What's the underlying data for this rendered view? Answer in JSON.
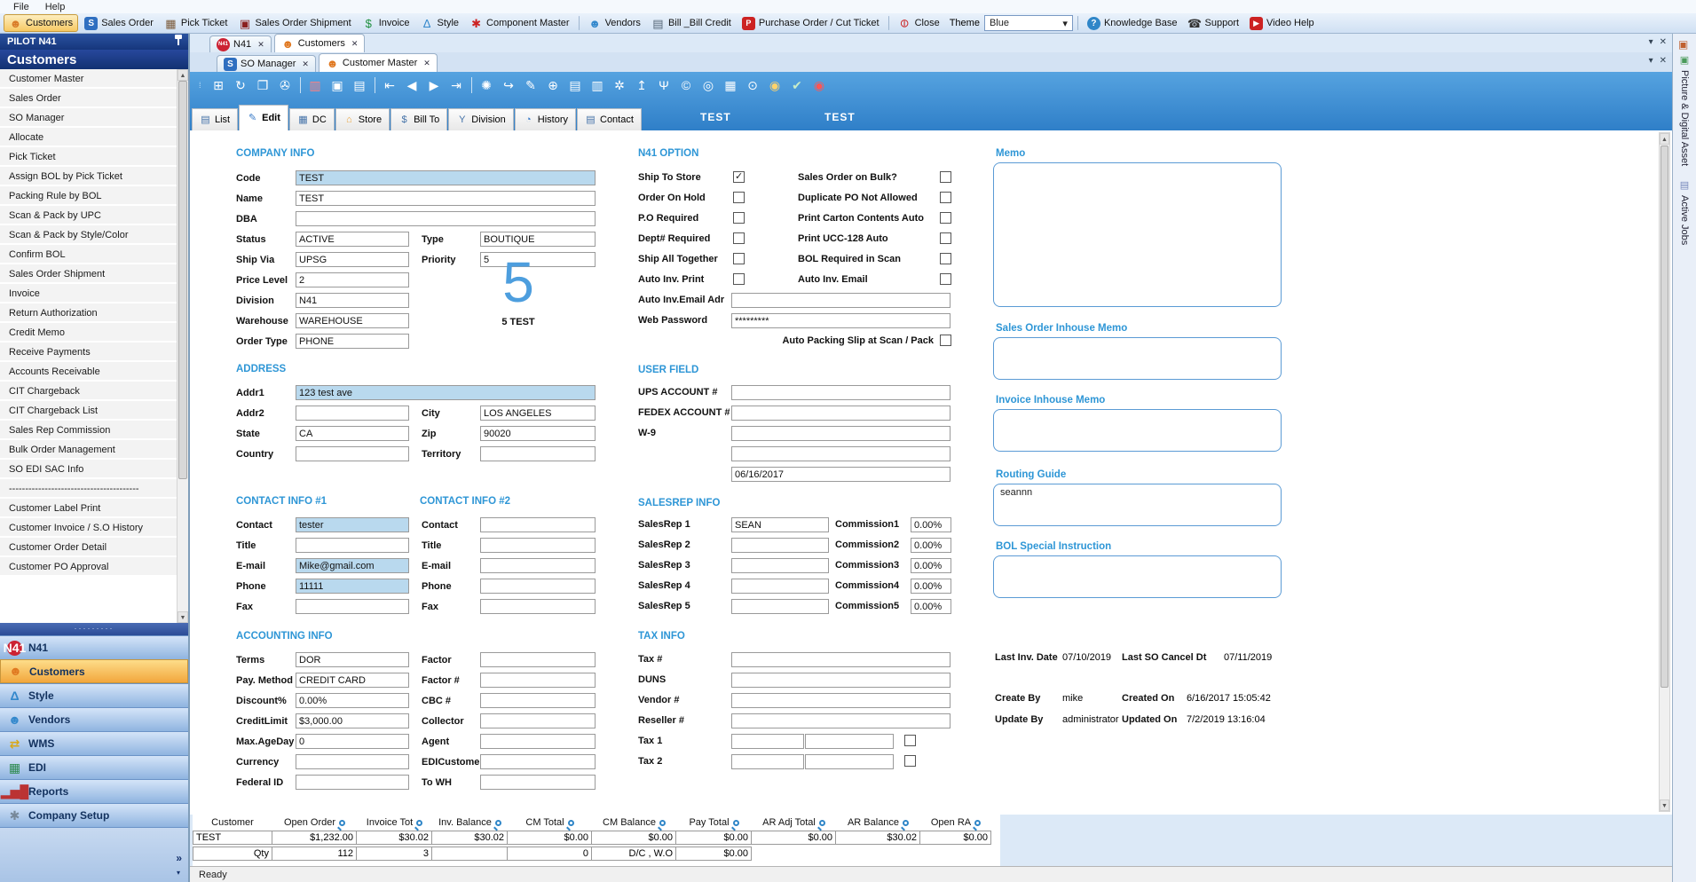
{
  "ui": {
    "close": "✕",
    "caret": "▾",
    "up": "▲",
    "down": "▼",
    "chevron": "»",
    "drag_dots": "⁞",
    "split_dots": "·········"
  },
  "menubar": {
    "items": [
      "File",
      "Help"
    ]
  },
  "toolbar": {
    "buttons": [
      {
        "label": "Customers",
        "icon": "customers-icon",
        "glyph": "☻",
        "color": "#d97c28",
        "active": true
      },
      {
        "label": "Sales Order",
        "icon": "sales-order-icon",
        "glyph": "S",
        "bb": true
      },
      {
        "label": "Pick Ticket",
        "icon": "pick-ticket-icon",
        "glyph": "▦",
        "color": "#7a5a3a"
      },
      {
        "label": "Sales Order Shipment",
        "icon": "shipment-icon",
        "glyph": "▣",
        "color": "#8b2020"
      },
      {
        "label": "Invoice",
        "icon": "invoice-icon",
        "glyph": "$",
        "color": "#1e8f3e"
      },
      {
        "label": "Style",
        "icon": "style-icon",
        "glyph": "Δ",
        "color": "#3388cc"
      },
      {
        "label": "Component Master",
        "icon": "component-master-icon",
        "glyph": "✱",
        "color": "#cc2222"
      },
      {
        "sep": true
      },
      {
        "label": "Vendors",
        "icon": "vendors-icon",
        "glyph": "☻",
        "color": "#3388cc"
      },
      {
        "label": "Bill _Bill Credit",
        "icon": "bill-credit-icon",
        "glyph": "▤",
        "color": "#556677"
      },
      {
        "label": "Purchase Order / Cut Ticket",
        "icon": "purchase-order-icon",
        "glyph": "P",
        "brect": true
      },
      {
        "sep": true
      },
      {
        "label": "Close",
        "icon": "close-icon",
        "glyph": "⊖",
        "color": "#cc2222",
        "rot": true
      }
    ],
    "theme": {
      "label": "Theme",
      "value": "Blue"
    },
    "help": [
      {
        "label": "Knowledge Base",
        "icon": "knowledge-base-icon",
        "glyph": "?",
        "bround": true
      },
      {
        "label": "Support",
        "icon": "support-icon",
        "glyph": "☎",
        "color": "#333333"
      },
      {
        "label": "Video Help",
        "icon": "video-help-icon",
        "glyph": "▶",
        "brect": true
      }
    ]
  },
  "sidebar": {
    "header": "PILOT N41",
    "title": "Customers",
    "items": [
      "Customer Master",
      "Sales Order",
      "SO Manager",
      "Allocate",
      "Pick Ticket",
      "Assign BOL by Pick Ticket",
      "Packing Rule by BOL",
      "Scan & Pack by UPC",
      "Scan & Pack by Style/Color",
      "Confirm BOL",
      "Sales Order Shipment",
      "Invoice",
      "Return Authorization",
      "Credit Memo",
      "Receive Payments",
      "Accounts Receivable",
      "CIT Chargeback",
      "CIT Chargeback List",
      "Sales Rep Commission",
      "Bulk Order Management",
      "SO EDI SAC Info",
      "----------------------------------------",
      "Customer Label Print",
      "Customer Invoice / S.O History",
      "Customer Order Detail",
      "Customer PO Approval"
    ],
    "sections": [
      {
        "label": "N41",
        "icon": "n41-icon",
        "glyph": "N41",
        "br": true
      },
      {
        "label": "Customers",
        "icon": "customers-icon",
        "glyph": "☻",
        "color": "#e07820",
        "active": true
      },
      {
        "label": "Style",
        "icon": "style-icon",
        "glyph": "Δ",
        "color": "#3388cc"
      },
      {
        "label": "Vendors",
        "icon": "vendors-icon",
        "glyph": "☻",
        "color": "#3388cc"
      },
      {
        "label": "WMS",
        "icon": "wms-icon",
        "glyph": "⇄",
        "color": "#d9a817"
      },
      {
        "label": "EDI",
        "icon": "edi-icon",
        "glyph": "▦",
        "color": "#2d8a4e"
      },
      {
        "label": "Reports",
        "icon": "reports-icon",
        "glyph": "▂▅█",
        "color": "#bb3333"
      },
      {
        "label": "Company Setup",
        "icon": "company-setup-icon",
        "glyph": "✱",
        "color": "#778899"
      }
    ]
  },
  "tabs1": [
    {
      "label": "N41",
      "icon": "n41-icon",
      "glyph": "N41",
      "br": true
    },
    {
      "label": "Customers",
      "icon": "customers-icon",
      "glyph": "☻",
      "color": "#e07820",
      "active": true
    }
  ],
  "tabs2": [
    {
      "label": "SO Manager",
      "icon": "so-manager-icon",
      "glyph": "S",
      "bb": true
    },
    {
      "label": "Customer Master",
      "icon": "customer-master-icon",
      "glyph": "☻",
      "color": "#e07820",
      "active": true
    }
  ],
  "bluebar": {
    "icons": [
      {
        "name": "new-record-icon",
        "glyph": "⊞"
      },
      {
        "name": "refresh-icon",
        "glyph": "↻"
      },
      {
        "name": "cascade-windows-icon",
        "glyph": "❐"
      },
      {
        "name": "tools-icon",
        "glyph": "✇"
      },
      {
        "sep": true
      },
      {
        "name": "delete-icon",
        "glyph": "▥",
        "color": "#ff8080"
      },
      {
        "name": "save-icon",
        "glyph": "▣"
      },
      {
        "name": "print-icon",
        "glyph": "▤"
      },
      {
        "sep": true
      },
      {
        "name": "first-record-icon",
        "glyph": "⇤"
      },
      {
        "name": "prev-record-icon",
        "glyph": "◀"
      },
      {
        "name": "next-record-icon",
        "glyph": "▶"
      },
      {
        "name": "last-record-icon",
        "glyph": "⇥"
      },
      {
        "sep": true
      },
      {
        "name": "settings-icon",
        "glyph": "✺"
      },
      {
        "name": "export-icon",
        "glyph": "↪"
      },
      {
        "name": "edit-doc-icon",
        "glyph": "✎"
      },
      {
        "name": "add-sales-order-icon",
        "glyph": "⊕"
      },
      {
        "name": "doc-icon",
        "glyph": "▤"
      },
      {
        "name": "cards-icon",
        "glyph": "▥"
      },
      {
        "name": "doc-settings-icon",
        "glyph": "✲"
      },
      {
        "name": "upload-icon",
        "glyph": "↥"
      },
      {
        "name": "hanger-icon",
        "glyph": "Ψ"
      },
      {
        "name": "copyright-icon",
        "glyph": "©"
      },
      {
        "name": "coin-doc-icon",
        "glyph": "◎"
      },
      {
        "name": "log-icon",
        "glyph": "▦"
      },
      {
        "name": "search-doc-icon",
        "glyph": "⊙"
      },
      {
        "name": "coin-doc2-icon",
        "glyph": "◉",
        "color": "#ffd36b"
      },
      {
        "name": "check-doc-icon",
        "glyph": "✔",
        "color": "#c8ecc8"
      },
      {
        "name": "map-pin-icon",
        "glyph": "◉",
        "color": "#ff5555"
      }
    ],
    "label1": "TEST",
    "label2": "TEST"
  },
  "subtabs": [
    {
      "label": "List",
      "icon": "list-icon",
      "glyph": "▤",
      "color": "#4472a8"
    },
    {
      "label": "Edit",
      "icon": "edit-icon",
      "glyph": "✎",
      "color": "#3a7bc8",
      "active": true
    },
    {
      "label": "DC",
      "icon": "dc-icon",
      "glyph": "▦",
      "color": "#4472a8"
    },
    {
      "label": "Store",
      "icon": "store-icon",
      "glyph": "⌂",
      "color": "#e8a33d"
    },
    {
      "label": "Bill To",
      "icon": "bill-to-icon",
      "glyph": "$",
      "color": "#4472a8"
    },
    {
      "label": "Division",
      "icon": "division-icon",
      "glyph": "Y",
      "color": "#4472a8"
    },
    {
      "label": "History",
      "icon": "history-icon",
      "glyph": "◔",
      "color": "#3a7bc8"
    },
    {
      "label": "Contact",
      "icon": "contact-icon",
      "glyph": "▤",
      "color": "#4472a8"
    }
  ],
  "form": {
    "company": {
      "title": "COMPANY INFO",
      "code": {
        "label": "Code",
        "value": "TEST"
      },
      "name": {
        "label": "Name",
        "value": "TEST"
      },
      "dba": {
        "label": "DBA",
        "value": ""
      },
      "status": {
        "label": "Status",
        "value": "ACTIVE"
      },
      "type": {
        "label": "Type",
        "value": "BOUTIQUE"
      },
      "shipvia": {
        "label": "Ship Via",
        "value": "UPSG"
      },
      "priority": {
        "label": "Priority",
        "value": "5"
      },
      "pricelevel": {
        "label": "Price Level",
        "value": "2"
      },
      "division": {
        "label": "Division",
        "value": "N41"
      },
      "warehouse": {
        "label": "Warehouse",
        "value": "WAREHOUSE"
      },
      "ordertype": {
        "label": "Order Type",
        "value": "PHONE"
      },
      "big_number": "5",
      "big_caption": "5 TEST"
    },
    "address": {
      "title": "ADDRESS",
      "addr1": {
        "label": "Addr1",
        "value": "123 test ave"
      },
      "addr2": {
        "label": "Addr2",
        "value": ""
      },
      "city": {
        "label": "City",
        "value": "LOS ANGELES"
      },
      "state": {
        "label": "State",
        "value": "CA"
      },
      "zip": {
        "label": "Zip",
        "value": "90020"
      },
      "country": {
        "label": "Country",
        "value": ""
      },
      "territory": {
        "label": "Territory",
        "value": ""
      }
    },
    "contact1": {
      "title": "CONTACT INFO #1",
      "rows": [
        {
          "label": "Contact",
          "value": "tester",
          "hl": true
        },
        {
          "label": "Title",
          "value": ""
        },
        {
          "label": "E-mail",
          "value": "Mike@gmail.com",
          "hl": true
        },
        {
          "label": "Phone",
          "value": "11111",
          "hl": true
        },
        {
          "label": "Fax",
          "value": ""
        }
      ]
    },
    "contact2": {
      "title": "CONTACT INFO #2",
      "rows": [
        {
          "label": "Contact",
          "value": ""
        },
        {
          "label": "Title",
          "value": ""
        },
        {
          "label": "E-mail",
          "value": ""
        },
        {
          "label": "Phone",
          "value": ""
        },
        {
          "label": "Fax",
          "value": ""
        }
      ]
    },
    "accounting": {
      "title": "ACCOUNTING INFO",
      "rows": [
        {
          "l": "Terms",
          "lv": "DOR",
          "r": "Factor",
          "rv": ""
        },
        {
          "l": "Pay. Method",
          "lv": "CREDIT CARD",
          "r": "Factor #",
          "rv": ""
        },
        {
          "l": "Discount%",
          "lv": "0.00%",
          "r": "CBC #",
          "rv": ""
        },
        {
          "l": "CreditLimit",
          "lv": "$3,000.00",
          "r": "Collector",
          "rv": ""
        },
        {
          "l": "Max.AgeDay",
          "lv": "0",
          "r": "Agent",
          "rv": ""
        },
        {
          "l": "Currency",
          "lv": "",
          "r": "EDICustomer",
          "rv": ""
        },
        {
          "l": "Federal ID",
          "lv": "",
          "r": "To WH",
          "rv": ""
        }
      ]
    },
    "n41option": {
      "title": "N41 OPTION",
      "left": [
        {
          "label": "Ship To Store",
          "checked": true
        },
        {
          "label": "Order On Hold",
          "checked": false
        },
        {
          "label": "P.O Required",
          "checked": false
        },
        {
          "label": "Dept# Required",
          "checked": false
        },
        {
          "label": "Ship All Together",
          "checked": false
        },
        {
          "label": "Auto Inv. Print",
          "checked": false
        }
      ],
      "right": [
        {
          "label": "Sales Order on Bulk?",
          "checked": false
        },
        {
          "label": "Duplicate PO Not Allowed",
          "checked": false
        },
        {
          "label": "Print Carton Contents Auto",
          "checked": false
        },
        {
          "label": "Print UCC-128 Auto",
          "checked": false
        },
        {
          "label": "BOL Required in Scan",
          "checked": false
        },
        {
          "label": "Auto Inv. Email",
          "checked": false
        }
      ],
      "email": {
        "label": "Auto Inv.Email Adr",
        "value": ""
      },
      "password": {
        "label": "Web Password",
        "value": "*********"
      },
      "packing": {
        "label": "Auto Packing Slip at Scan / Pack",
        "checked": false
      }
    },
    "userfield": {
      "title": "USER FIELD",
      "rows": [
        {
          "label": "UPS ACCOUNT #",
          "value": ""
        },
        {
          "label": "FEDEX ACCOUNT #",
          "value": ""
        },
        {
          "label": "W-9",
          "value": ""
        },
        {
          "label": "",
          "value": ""
        },
        {
          "label": "",
          "value": "06/16/2017"
        }
      ]
    },
    "salesrep": {
      "title": "SALESREP INFO",
      "rows": [
        {
          "label": "SalesRep 1",
          "value": "SEAN",
          "clabel": "Commission1",
          "cvalue": "0.00%"
        },
        {
          "label": "SalesRep 2",
          "value": "",
          "clabel": "Commission2",
          "cvalue": "0.00%"
        },
        {
          "label": "SalesRep 3",
          "value": "",
          "clabel": "Commission3",
          "cvalue": "0.00%"
        },
        {
          "label": "SalesRep 4",
          "value": "",
          "clabel": "Commission4",
          "cvalue": "0.00%"
        },
        {
          "label": "SalesRep 5",
          "value": "",
          "clabel": "Commission5",
          "cvalue": "0.00%"
        }
      ]
    },
    "taxinfo": {
      "title": "TAX INFO",
      "rows": [
        {
          "label": "Tax #",
          "value": ""
        },
        {
          "label": "DUNS",
          "value": ""
        },
        {
          "label": "Vendor #",
          "value": ""
        },
        {
          "label": "Reseller #",
          "value": ""
        }
      ],
      "taxrows": [
        {
          "label": "Tax 1"
        },
        {
          "label": "Tax 2"
        }
      ]
    },
    "memos": {
      "memo": {
        "title": "Memo",
        "value": ""
      },
      "so_inhouse": {
        "title": "Sales Order Inhouse Memo",
        "value": ""
      },
      "invoice_inhouse": {
        "title": "Invoice Inhouse Memo",
        "value": ""
      },
      "routing": {
        "title": "Routing Guide",
        "value": "seannn"
      },
      "bol": {
        "title": "BOL Special Instruction",
        "value": ""
      }
    },
    "audit": {
      "last_inv_label": "Last Inv. Date",
      "last_inv_value": "07/10/2019",
      "last_so_label": "Last SO Cancel Dt",
      "last_so_value": "07/11/2019",
      "create_by_label": "Create By",
      "create_by_value": "mike",
      "created_on_label": "Created On",
      "created_on_value": "6/16/2017 15:05:42",
      "update_by_label": "Update By",
      "update_by_value": "administrator",
      "updated_on_label": "Updated On",
      "updated_on_value": "7/2/2019 13:16:04"
    }
  },
  "table": {
    "headers": [
      {
        "label": "Customer",
        "search": false
      },
      {
        "label": "Open Order",
        "search": true
      },
      {
        "label": "Invoice Tot",
        "search": true
      },
      {
        "label": "Inv. Balance",
        "search": true
      },
      {
        "label": "CM Total",
        "search": true
      },
      {
        "label": "CM Balance",
        "search": true
      },
      {
        "label": "Pay Total",
        "search": true
      },
      {
        "label": "AR Adj Total",
        "search": true
      },
      {
        "label": "AR Balance",
        "search": true
      },
      {
        "label": "Open RA",
        "search": true
      }
    ],
    "row1": [
      "TEST",
      "$1,232.00",
      "$30.02",
      "$30.02",
      "$0.00",
      "$0.00",
      "$0.00",
      "$0.00",
      "$30.02",
      "$0.00"
    ],
    "row2": [
      "Qty",
      "112",
      "3",
      "",
      "0",
      "D/C , W.O",
      "$0.00",
      "",
      "",
      ""
    ]
  },
  "statusbar": {
    "text": "Ready"
  },
  "dock": {
    "tabs": [
      {
        "label": "Picture & Digital Asset",
        "icon": "picture-asset-icon",
        "glyph": "▣",
        "color": "#4a9a5a"
      },
      {
        "label": "Active Jobs",
        "icon": "active-jobs-icon",
        "glyph": "▤",
        "color": "#7788bb"
      }
    ]
  }
}
